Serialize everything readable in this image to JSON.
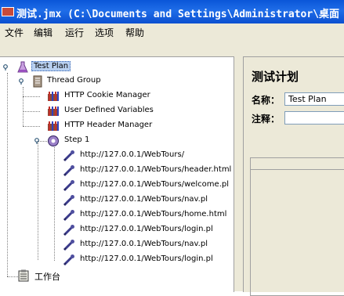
{
  "window": {
    "title": "测试.jmx (C:\\Documents and Settings\\Administrator\\桌面"
  },
  "menu": [
    "文件",
    "编辑",
    "运行",
    "选项",
    "帮助"
  ],
  "tree": {
    "root": "Test Plan",
    "thread_group": "Thread Group",
    "config": [
      "HTTP Cookie Manager",
      "User Defined Variables",
      "HTTP Header Manager"
    ],
    "controller": "Step 1",
    "samplers": [
      "http://127.0.0.1/WebTours/",
      "http://127.0.0.1/WebTours/header.html",
      "http://127.0.0.1/WebTours/welcome.pl",
      "http://127.0.0.1/WebTours/nav.pl",
      "http://127.0.0.1/WebTours/home.html",
      "http://127.0.0.1/WebTours/login.pl",
      "http://127.0.0.1/WebTours/nav.pl",
      "http://127.0.0.1/WebTours/login.pl"
    ],
    "workbench": "工作台"
  },
  "panel": {
    "title": "测试计划",
    "name_label": "名称：",
    "name_value": "Test Plan",
    "comment_label": "注释："
  }
}
